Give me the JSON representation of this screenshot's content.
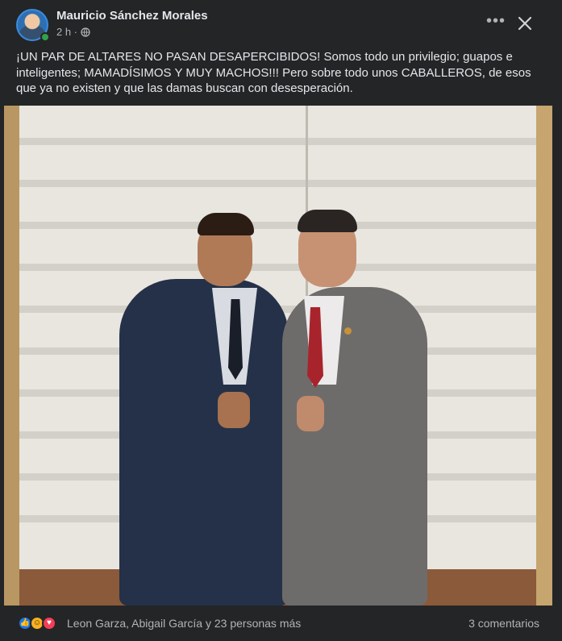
{
  "post": {
    "author": "Mauricio Sánchez Morales",
    "time": "2 h ·",
    "audience_icon": "globe-icon",
    "menu_icon": "more-options-icon",
    "close_icon": "close-icon",
    "caption": "¡UN PAR DE ALTARES NO PASAN DESAPERCIBIDOS! Somos todo un privilegio; guapos e inteligentes; MAMADÍSIMOS Y MUY MACHOS!!! Pero sobre todo unos CABALLEROS, de esos que ya no existen y que las damas buscan con desesperación."
  },
  "reactions": {
    "icons": [
      "like-icon",
      "haha-icon",
      "love-icon"
    ],
    "summary": "Leon Garza, Abigail García y 23 personas más",
    "comments": "3 comentarios"
  },
  "colors": {
    "background": "#242526",
    "text_primary": "#e4e6eb",
    "text_secondary": "#b0b3b8",
    "like": "#1877f2",
    "love": "#f33e58",
    "haha": "#f7b125",
    "online": "#31a24c"
  }
}
